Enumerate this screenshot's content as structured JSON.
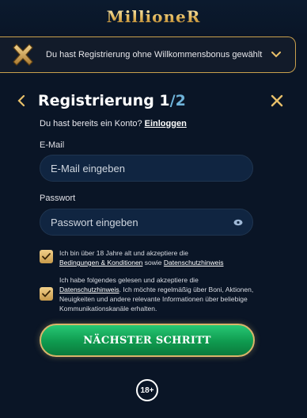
{
  "header": {
    "logo": "MillioneR"
  },
  "banner": {
    "text": "Du hast Registrierung ohne Willkommensbonus gewählt"
  },
  "form": {
    "title": "Registrierung 1",
    "step_suffix": "/2",
    "login_prompt": "Du hast bereits ein Konto?",
    "login_link": "Einloggen",
    "email_label": "E-Mail",
    "email_placeholder": "E-Mail eingeben",
    "password_label": "Passwort",
    "password_placeholder": "Passwort eingeben",
    "terms": {
      "text_1": "Ich bin über 18 Jahre alt und akzeptiere die",
      "link_1": "Bedingungen & Konditionen",
      "text_2": "sowie",
      "link_2": "Datenschutzhinweis",
      "checked": true
    },
    "marketing": {
      "text_1": "Ich habe folgendes gelesen und akzeptiere die",
      "link_1": "Datenschutzhinweis",
      "text_2": ". Ich möchte regelmäßig über Boni, Aktionen, Neuigkeiten und andere relevante Informationen über beliebige Kommunikationskanäle erhalten.",
      "checked": true
    },
    "next_button": "NÄCHSTER SCHRITT",
    "age_badge": "18+"
  },
  "colors": {
    "background": "#0a1526",
    "gold": "#c9a04d",
    "accent_blue": "#6fb3d9",
    "button_green": "#14a85a"
  },
  "icons": {
    "banner": "no-bonus-x-icon",
    "banner_toggle": "chevron-down-icon",
    "back": "chevron-left-icon",
    "close": "close-icon",
    "password": "eye-icon",
    "checkbox": "checkmark-icon"
  }
}
